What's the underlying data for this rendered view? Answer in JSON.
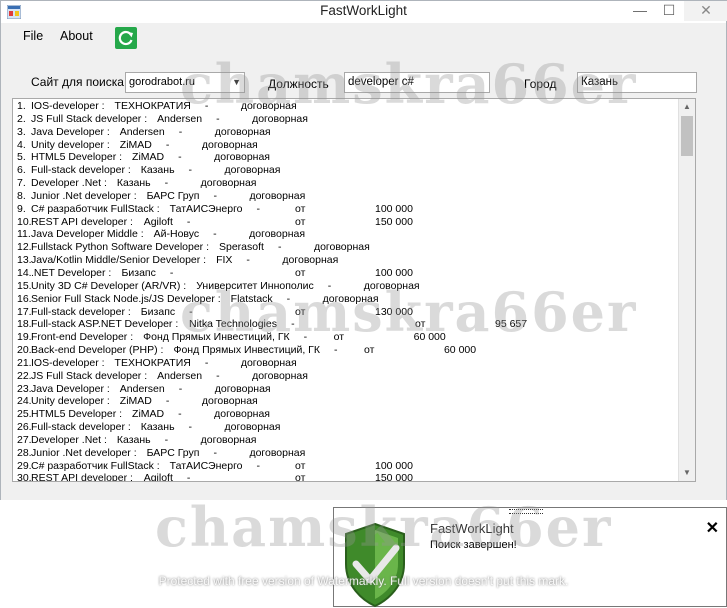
{
  "window": {
    "title": "FastWorkLight",
    "min_glyph": "—",
    "max_glyph": "☐",
    "close_glyph": "✕"
  },
  "menu": {
    "file": "File",
    "about": "About"
  },
  "toolbar": {
    "refresh_icon": "refresh-icon"
  },
  "search": {
    "site_label": "Сайт для поиска",
    "site_value": "gorodrabot.ru",
    "position_label": "Должность",
    "position_value": "developer c#",
    "city_label": "Город",
    "city_value": "Казань"
  },
  "results": [
    {
      "n": "1.",
      "title": "IOS-developer :",
      "company": "ТЕХНОКРАТИЯ",
      "dash": "-",
      "from": "",
      "salary": "договорная"
    },
    {
      "n": "2.",
      "title": "JS Full Stack developer :",
      "company": "Andersen",
      "dash": "-",
      "from": "",
      "salary": "договорная"
    },
    {
      "n": "3.",
      "title": "Java Developer :",
      "company": "Andersen",
      "dash": "-",
      "from": "",
      "salary": "договорная"
    },
    {
      "n": "4.",
      "title": "Unity developer :",
      "company": "ZiMAD",
      "dash": "-",
      "from": "",
      "salary": "договорная"
    },
    {
      "n": "5.",
      "title": "HTML5 Developer :",
      "company": "ZiMAD",
      "dash": "-",
      "from": "",
      "salary": "договорная"
    },
    {
      "n": "6.",
      "title": "Full-stack developer :",
      "company": "Казань",
      "dash": "-",
      "from": "",
      "salary": "договорная"
    },
    {
      "n": "7.",
      "title": "Developer .Net :",
      "company": "Казань",
      "dash": "-",
      "from": "",
      "salary": "договорная"
    },
    {
      "n": "8.",
      "title": "Junior .Net developer :",
      "company": "БАРС Груп",
      "dash": "-",
      "from": "",
      "salary": "договорная"
    },
    {
      "n": "9.",
      "title": "C# разработчик FullStack :",
      "company": "ТатАИСЭнерго",
      "dash": "-",
      "from": "от",
      "salary": "100 000"
    },
    {
      "n": "10.",
      "title": "REST API developer :",
      "company": "Agiloft",
      "dash": "-",
      "from": "от",
      "salary": "150 000"
    },
    {
      "n": "11.",
      "title": "Java Developer Middle :",
      "company": "Ай-Новус",
      "dash": "-",
      "from": "",
      "salary": "договорная"
    },
    {
      "n": "12.",
      "title": "Fullstack Python Software Developer :",
      "company": "Sperasoft",
      "dash": "-",
      "from": "",
      "salary": "договорная"
    },
    {
      "n": "13.",
      "title": "Java/Kotlin Middle/Senior Developer :",
      "company": "FIX",
      "dash": "-",
      "from": "",
      "salary": "договорная"
    },
    {
      "n": "14.",
      "title": ".NET Developer :",
      "company": "Бизапс",
      "dash": "-",
      "from": "от",
      "salary": "100 000"
    },
    {
      "n": "15.",
      "title": "Unity 3D C# Developer (AR/VR) :",
      "company": "Университет Иннополис",
      "dash": "-",
      "from": "",
      "salary": "договорная"
    },
    {
      "n": "16.",
      "title": "Senior Full Stack Node.js/JS Developer :",
      "company": "Flatstack",
      "dash": "-",
      "from": "",
      "salary": "договорная"
    },
    {
      "n": "17.",
      "title": "Full-stack developer :",
      "company": "Бизапс",
      "dash": "-",
      "from": "от",
      "salary": "130 000"
    },
    {
      "n": "18.",
      "title": "Full-stack ASP.NET Developer :",
      "company": "Nitka Technologies",
      "dash": "-",
      "from": "от",
      "salary": "95 657"
    },
    {
      "n": "19.",
      "title": "Front-end Developer :",
      "company": "Фонд Прямых Инвестиций, ГК",
      "dash": "-",
      "from": "от",
      "salary": "60 000"
    },
    {
      "n": "20.",
      "title": "Back-end Developer (PHP) :",
      "company": "Фонд Прямых Инвестиций, ГК",
      "dash": "-",
      "from": "от",
      "salary": "60 000"
    },
    {
      "n": "21.",
      "title": "IOS-developer :",
      "company": "ТЕХНОКРАТИЯ",
      "dash": "-",
      "from": "",
      "salary": "договорная"
    },
    {
      "n": "22.",
      "title": "JS Full Stack developer :",
      "company": "Andersen",
      "dash": "-",
      "from": "",
      "salary": "договорная"
    },
    {
      "n": "23.",
      "title": "Java Developer :",
      "company": "Andersen",
      "dash": "-",
      "from": "",
      "salary": "договорная"
    },
    {
      "n": "24.",
      "title": "Unity developer :",
      "company": "ZiMAD",
      "dash": "-",
      "from": "",
      "salary": "договорная"
    },
    {
      "n": "25.",
      "title": "HTML5 Developer :",
      "company": "ZiMAD",
      "dash": "-",
      "from": "",
      "salary": "договорная"
    },
    {
      "n": "26.",
      "title": "Full-stack developer :",
      "company": "Казань",
      "dash": "-",
      "from": "",
      "salary": "договорная"
    },
    {
      "n": "27.",
      "title": "Developer .Net :",
      "company": "Казань",
      "dash": "-",
      "from": "",
      "salary": "договорная"
    },
    {
      "n": "28.",
      "title": "Junior .Net developer :",
      "company": "БАРС Груп",
      "dash": "-",
      "from": "",
      "salary": "договорная"
    },
    {
      "n": "29.",
      "title": "C# разработчик FullStack :",
      "company": "ТатАИСЭнерго",
      "dash": "-",
      "from": "от",
      "salary": "100 000"
    },
    {
      "n": "30.",
      "title": "REST API developer :",
      "company": "Agiloft",
      "dash": "-",
      "from": "от",
      "salary": "150 000"
    }
  ],
  "scrollbar": {
    "up_glyph": "▲",
    "down_glyph": "▼"
  },
  "notification": {
    "title": "FastWorkLight",
    "message": "Поиск завершен!",
    "close_glyph": "✕",
    "icon": "shield-check-icon"
  },
  "watermarks": {
    "text": "chamskra66er",
    "footer": "Protected with free version of Watermarkly. Full version doesn't put this mark."
  }
}
